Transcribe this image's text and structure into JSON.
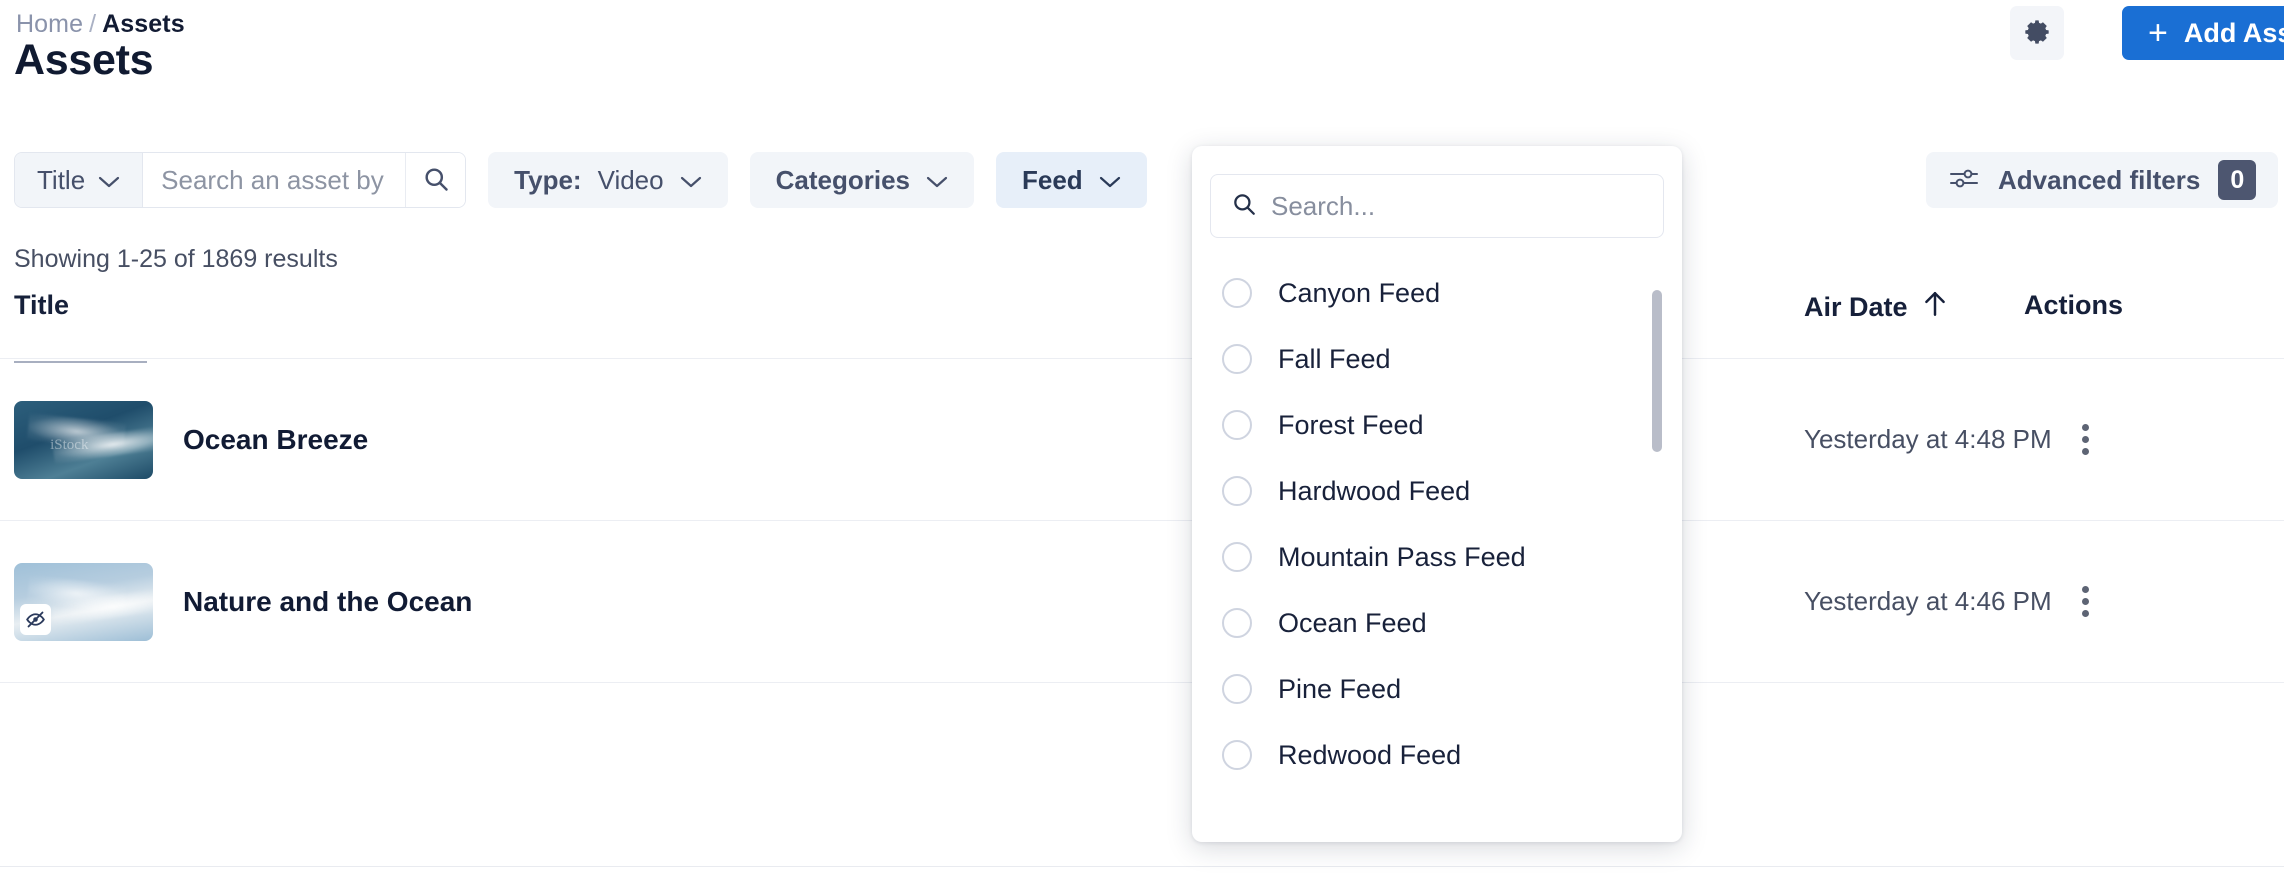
{
  "header": {
    "breadcrumb": {
      "home": "Home",
      "separator": "/",
      "current": "Assets"
    },
    "title": "Assets",
    "gear_icon": "gear-icon",
    "add_button": {
      "label": "Add Asset",
      "plus": "+",
      "color": "#1a6fd4"
    }
  },
  "toolbar": {
    "search_select": {
      "label": "Title",
      "chevron": "chevron-down-icon"
    },
    "search_input": {
      "value": "",
      "placeholder": "Search an asset by title."
    },
    "search_button_icon": "search-icon",
    "chips": [
      {
        "prefix": "Type:",
        "value": "Video",
        "active": false
      },
      {
        "prefix": "Categories",
        "value": "",
        "active": false
      },
      {
        "prefix": "Feed",
        "value": "",
        "active": true
      }
    ],
    "advanced_filters": {
      "label": "Advanced filters",
      "count": "0",
      "icon": "sliders-icon"
    }
  },
  "results": {
    "showing": "Showing 1-25 of 1869 results"
  },
  "table": {
    "columns": {
      "title": "Title",
      "air_date": "Air Date",
      "actions": "Actions"
    },
    "sort": {
      "column": "Air Date",
      "direction": "ascending",
      "icon": "arrow-up-icon"
    },
    "rows": [
      {
        "title": "Ocean Breeze",
        "air_date": "Yesterday at 4:48 PM",
        "thumbnail_watermark": "iStock",
        "hidden_badge": false,
        "actions_icon": "kebab-menu-icon"
      },
      {
        "title": "Nature and the Ocean",
        "air_date": "Yesterday at 4:46 PM",
        "thumbnail_watermark": "",
        "hidden_badge": true,
        "hidden_badge_icon": "eye-off-icon",
        "actions_icon": "kebab-menu-icon"
      }
    ]
  },
  "feed_dropdown": {
    "open": true,
    "search": {
      "value": "",
      "placeholder": "Search...",
      "icon": "search-icon"
    },
    "options": [
      {
        "label": "Canyon Feed",
        "selected": false
      },
      {
        "label": "Fall Feed",
        "selected": false
      },
      {
        "label": "Forest Feed",
        "selected": false
      },
      {
        "label": "Hardwood Feed",
        "selected": false
      },
      {
        "label": "Mountain Pass Feed",
        "selected": false
      },
      {
        "label": "Ocean Feed",
        "selected": false
      },
      {
        "label": "Pine Feed",
        "selected": false
      },
      {
        "label": "Redwood Feed",
        "selected": false
      }
    ]
  }
}
